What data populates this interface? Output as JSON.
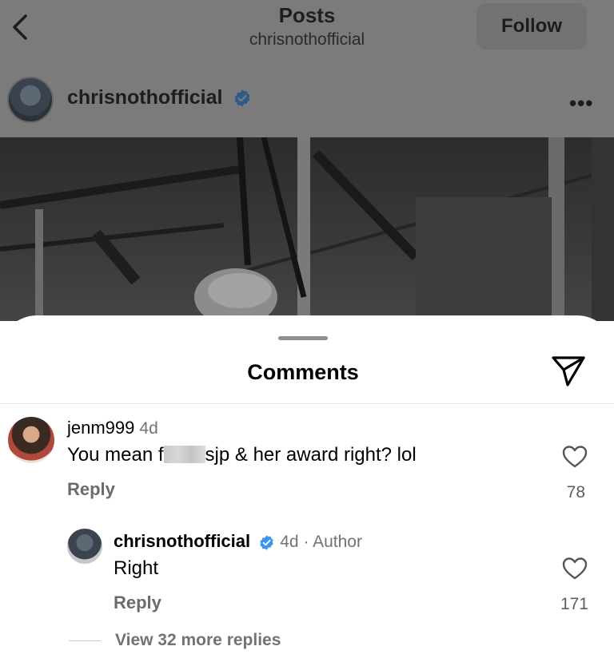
{
  "header": {
    "title": "Posts",
    "subtitle": "chrisnothofficial",
    "follow_label": "Follow"
  },
  "post": {
    "username": "chrisnothofficial",
    "verified": true,
    "more_glyph": "•••"
  },
  "sheet": {
    "title": "Comments",
    "share_icon": "send-icon"
  },
  "comments": [
    {
      "username": "jenm999",
      "time": "4d",
      "text_before": "You mean f",
      "text_after": "sjp & her award right? lol",
      "reply_label": "Reply",
      "likes": "78"
    },
    {
      "username": "chrisnothofficial",
      "verified": true,
      "time": "4d · Author",
      "text": "Right",
      "reply_label": "Reply",
      "likes": "171"
    }
  ],
  "view_more": "View 32 more replies",
  "colors": {
    "overlay_gray": "#7b7b7b",
    "verified_blue": "#3797f0",
    "muted_text": "#737373"
  }
}
